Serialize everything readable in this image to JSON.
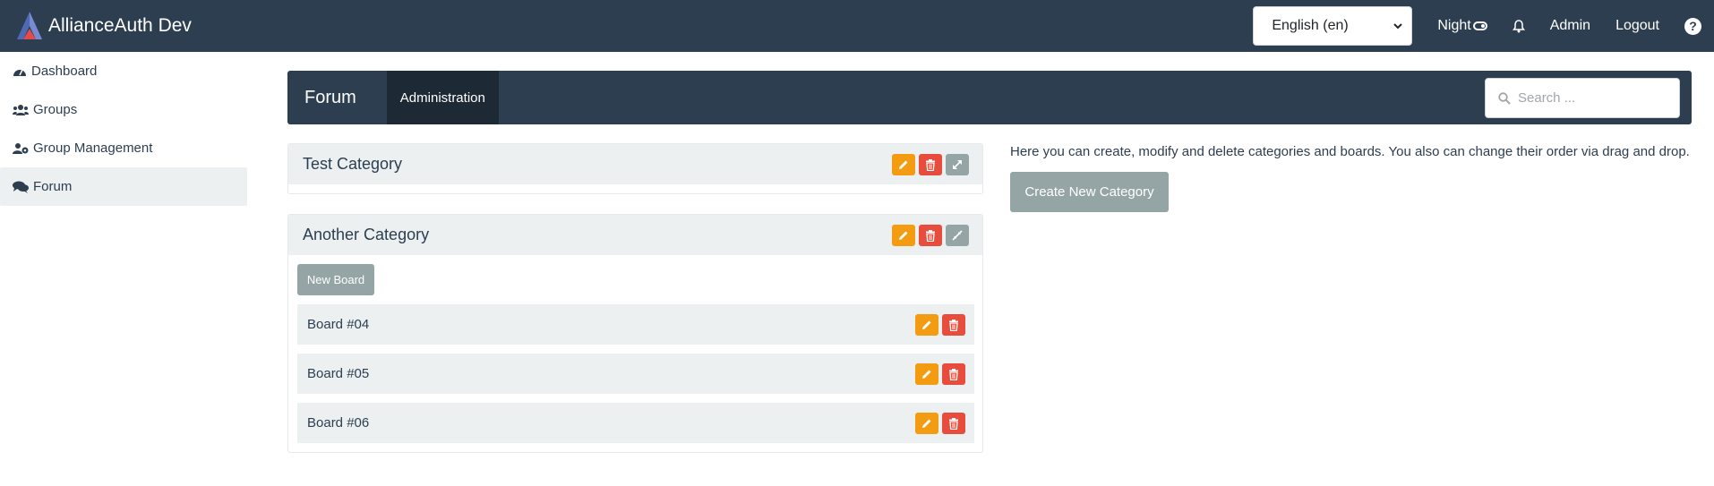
{
  "navbar": {
    "brand": "AllianceAuth Dev",
    "language": "English (en)",
    "night_label": "Night",
    "admin_label": "Admin",
    "logout_label": "Logout"
  },
  "sidebar": {
    "items": [
      {
        "label": "Dashboard",
        "icon": "dashboard-icon"
      },
      {
        "label": "Groups",
        "icon": "users-icon"
      },
      {
        "label": "Group Management",
        "icon": "users-cog-icon"
      },
      {
        "label": "Forum",
        "icon": "comments-icon",
        "active": true
      }
    ]
  },
  "forum_header": {
    "title": "Forum",
    "tab": "Administration",
    "search_placeholder": "Search ..."
  },
  "categories": [
    {
      "title": "Test Category",
      "boards": []
    },
    {
      "title": "Another Category",
      "new_board_label": "New Board",
      "boards": [
        "Board #04",
        "Board #05",
        "Board #06"
      ]
    }
  ],
  "info": {
    "text": "Here you can create, modify and delete categories and boards. You also can change their order via drag and drop.",
    "create_label": "Create New Category"
  },
  "colors": {
    "navbar": "#2c3e50",
    "warning": "#f39c12",
    "danger": "#e74c3c",
    "secondary": "#95a5a6",
    "light": "#ecf0f1"
  }
}
